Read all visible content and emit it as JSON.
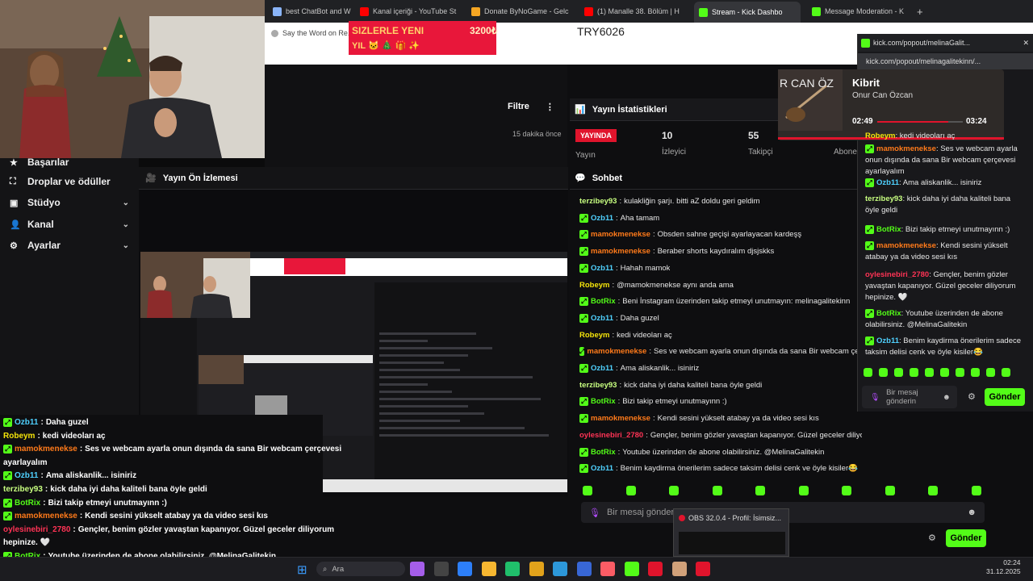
{
  "browser": {
    "tabs": [
      {
        "label": "best ChatBot and W",
        "color": "#8ab4f8"
      },
      {
        "label": "Kanal içeriği - YouTube St",
        "color": "#ff0000"
      },
      {
        "label": "Donate ByNoGame - Gelc",
        "color": "#f5a623"
      },
      {
        "label": "(1) Manalle 38. Bölüm | H",
        "color": "#ff0000"
      },
      {
        "label": "Stream - Kick Dashbo",
        "color": "#53fc18"
      },
      {
        "label": "Message Moderation - K",
        "color": "#53fc18"
      }
    ],
    "bookmark": "Say the Word on Re..."
  },
  "donation": {
    "line1": "SIZLERLE YENI",
    "line2": "YIL 🐱 🎄 🎁 ✨",
    "amount": "3200₺",
    "code": "TRY6026"
  },
  "popup_window": {
    "url_short": "kick.com/popout/melinaGalit...",
    "url_full": "kick.com/popout/melinagalitekinn/...",
    "song_title": "Kibrit",
    "artist": "Onur Can Özcan",
    "time_elapsed": "02:49",
    "time_total": "03:24",
    "input_placeholder": "Bir mesaj gönderin",
    "send_label": "Gönder",
    "messages": [
      {
        "user": "Robeym",
        "text": "kedi videoları aç",
        "color": "#f5e50a",
        "badge": false
      },
      {
        "user": "mamokmenekse",
        "text": "Ses ve webcam ayarla onun dışında da sana Bir webcam çerçevesi ayarlayalım",
        "color": "#ff7a1a",
        "badge": true
      },
      {
        "user": "Ozb11",
        "text": "Ama aliskanlik... isiniriz",
        "color": "#4fd1ff",
        "badge": true
      },
      {
        "user": "terzibey93",
        "text": "kick daha iyi daha kaliteli bana öyle geldi",
        "color": "#c8ff80",
        "badge": false
      },
      {
        "user": "BotRix",
        "text": "Bizi takip etmeyi unutmayınn :)",
        "color": "#53fc18",
        "badge": true
      },
      {
        "user": "mamokmenekse",
        "text": "Kendi sesini yükselt atabay ya da video sesi kıs",
        "color": "#ff7a1a",
        "badge": true
      },
      {
        "user": "oylesinebiri_2780",
        "text": "Gençler, benim gözler yavaştan kapanıyor. Güzel geceler diliyorum hepinize. 🤍",
        "color": "#ff3355",
        "badge": false
      },
      {
        "user": "BotRix",
        "text": "Youtube üzerinden de abone olabilirsiniz. @MelinaGalitekin",
        "color": "#53fc18",
        "badge": true
      },
      {
        "user": "Ozb11",
        "text": "Benim kaydirma önerilerim sadece taksim delisi cenk ve öyle kisiler😂",
        "color": "#4fd1ff",
        "badge": true
      }
    ]
  },
  "dashboard": {
    "filter_label": "Filtre",
    "time_ago": "15 dakika önce",
    "stats_title": "Yayın İstatistikleri",
    "live_badge": "YAYINDA",
    "live_sub": "Yayın",
    "viewers": "10",
    "viewers_label": "İzleyici",
    "followers": "55",
    "followers_label": "Takipçi",
    "subs_label": "Abone",
    "preview_title": "Yayın Ön İzlemesi",
    "chat_title": "Sohbet",
    "chat_placeholder": "Bir mesaj gönderin",
    "send_label": "Gönder",
    "nav": [
      {
        "label": "Başarılar",
        "chevron": false
      },
      {
        "label": "Droplar ve ödüller",
        "chevron": false
      },
      {
        "label": "Stüdyo",
        "chevron": true
      },
      {
        "label": "Kanal",
        "chevron": true
      },
      {
        "label": "Ayarlar",
        "chevron": true
      }
    ],
    "chat": [
      {
        "user": "terzibey93",
        "text": "kulakliğin şarjı. bitti aZ doldu geri geldim",
        "color": "#c8ff80",
        "badge": false
      },
      {
        "user": "Ozb11",
        "text": "Aha tamam",
        "color": "#4fd1ff",
        "badge": true
      },
      {
        "user": "mamokmenekse",
        "text": "Obsden sahne geçişi ayarlayacan kardeşş",
        "color": "#ff7a1a",
        "badge": true
      },
      {
        "user": "mamokmenekse",
        "text": "Beraber shorts kaydıralım djsjskks",
        "color": "#ff7a1a",
        "badge": true
      },
      {
        "user": "Ozb11",
        "text": "Hahah mamok",
        "color": "#4fd1ff",
        "badge": true
      },
      {
        "user": "Robeym",
        "text": "@mamokmenekse aynı anda ama",
        "color": "#f5e50a",
        "badge": false
      },
      {
        "user": "BotRix",
        "text": "Beni İnstagram üzerinden takip etmeyi unutmayın: melinagalitekinn",
        "color": "#53fc18",
        "badge": true
      },
      {
        "user": "Ozb11",
        "text": "Daha guzel",
        "color": "#4fd1ff",
        "badge": true
      },
      {
        "user": "Robeym",
        "text": "kedi videoları aç",
        "color": "#f5e50a",
        "badge": false
      },
      {
        "user": "mamokmenekse",
        "text": "Ses ve webcam ayarla onun dışında da sana Bir webcam çerçe",
        "color": "#ff7a1a",
        "badge": true
      },
      {
        "user": "Ozb11",
        "text": "Ama aliskanlik... isiniriz",
        "color": "#4fd1ff",
        "badge": true
      },
      {
        "user": "terzibey93",
        "text": "kick daha iyi daha kaliteli bana öyle geldi",
        "color": "#c8ff80",
        "badge": false
      },
      {
        "user": "BotRix",
        "text": "Bizi takip etmeyi unutmayınn :)",
        "color": "#53fc18",
        "badge": true
      },
      {
        "user": "mamokmenekse",
        "text": "Kendi sesini yükselt atabay ya da video sesi kıs",
        "color": "#ff7a1a",
        "badge": true
      },
      {
        "user": "oylesinebiri_2780",
        "text": "Gençler, benim gözler yavaştan kapanıyor. Güzel geceler diliyorum hepinize. 🤍",
        "color": "#ff3355",
        "badge": false
      },
      {
        "user": "BotRix",
        "text": "Youtube üzerinden de abone olabilirsiniz. @MelinaGalitekin",
        "color": "#53fc18",
        "badge": true
      },
      {
        "user": "Ozb11",
        "text": "Benim kaydirma önerilerim sadece taksim delisi cenk ve öyle kisiler😂",
        "color": "#4fd1ff",
        "badge": true
      }
    ]
  },
  "overlay_chat": [
    {
      "user": "Ozb11",
      "text": "Daha guzel",
      "color": "#4fd1ff",
      "badge": true
    },
    {
      "user": "Robeym",
      "text": "kedi videoları aç",
      "color": "#f5e50a",
      "badge": false
    },
    {
      "user": "mamokmenekse",
      "text": "Ses ve webcam ayarla onun dışında da sana Bir webcam çerçevesi",
      "color": "#ff7a1a",
      "badge": true
    },
    {
      "user": "",
      "text": "ayarlayalım",
      "color": "#ffffff",
      "badge": false
    },
    {
      "user": "Ozb11",
      "text": "Ama aliskanlik... isiniriz",
      "color": "#4fd1ff",
      "badge": true
    },
    {
      "user": "terzibey93",
      "text": "kick daha iyi daha kaliteli bana öyle geldi",
      "color": "#c8ff80",
      "badge": false
    },
    {
      "user": "BotRix",
      "text": "Bizi takip etmeyi unutmayınn :)",
      "color": "#53fc18",
      "badge": true
    },
    {
      "user": "mamokmenekse",
      "text": "Kendi sesini yükselt atabay ya da video sesi kıs",
      "color": "#ff7a1a",
      "badge": true
    },
    {
      "user": "oylesinebiri_2780",
      "text": "Gençler, benim gözler yavaştan kapanıyor. Güzel geceler diliyorum",
      "color": "#ff3355",
      "badge": false
    },
    {
      "user": "",
      "text": "hepinize. 🤍",
      "color": "#ffffff",
      "badge": false
    },
    {
      "user": "BotRix",
      "text": "Youtube üzerinden de abone olabilirsiniz. @MelinaGalitekin",
      "color": "#53fc18",
      "badge": true
    },
    {
      "user": "Ozb11",
      "text": "Benim kaydirma önerilerim sadece taksim delisi cenk ve öyle kisiler😂",
      "color": "#4fd1ff",
      "badge": true
    }
  ],
  "obs_popup": {
    "title": "OBS 32.0.4 - Profil: İsimsiz..."
  },
  "taskbar": {
    "search": "Ara",
    "time": "02:24",
    "date": "31.12.2025"
  }
}
